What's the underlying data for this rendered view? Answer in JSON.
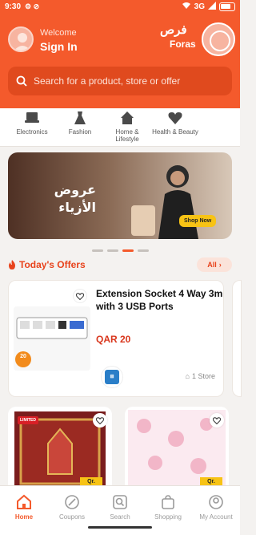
{
  "status_bar": {
    "time": "9:30",
    "network": "3G"
  },
  "header": {
    "welcome": "Welcome",
    "sign_in": "Sign In",
    "brand_arabic": "فرص",
    "brand_english": "Foras"
  },
  "search": {
    "placeholder": "Search for a product, store or offer"
  },
  "categories": [
    {
      "label": "Electronics",
      "icon": "electronics-icon"
    },
    {
      "label": "Fashion",
      "icon": "dress-icon"
    },
    {
      "label": "Home & Lifestyle",
      "icon": "home-icon"
    },
    {
      "label": "Health & Beauty",
      "icon": "heart-icon"
    }
  ],
  "banner": {
    "title_arabic_line1": "عروض",
    "title_arabic_line2": "الأزياء",
    "button": "Shop Now"
  },
  "carousel": {
    "count": 4,
    "active_index": 2
  },
  "offers_section": {
    "title": "Today's Offers",
    "all_label": "All"
  },
  "offer": {
    "title": "Extension Socket 4 Way 3m with 3 USB Ports",
    "price": "QAR 20",
    "store_count": "1 Store",
    "tag_price": "20"
  },
  "tiles": [
    {
      "tag": "Qr.",
      "badge": "LIMITED"
    },
    {
      "tag": "Qr."
    }
  ],
  "tabbar": {
    "items": [
      "Home",
      "Coupons",
      "Search",
      "Shopping",
      "My Account"
    ],
    "active": "Home"
  },
  "colors": {
    "brand": "#f45a2c",
    "accent": "#e8431c"
  }
}
